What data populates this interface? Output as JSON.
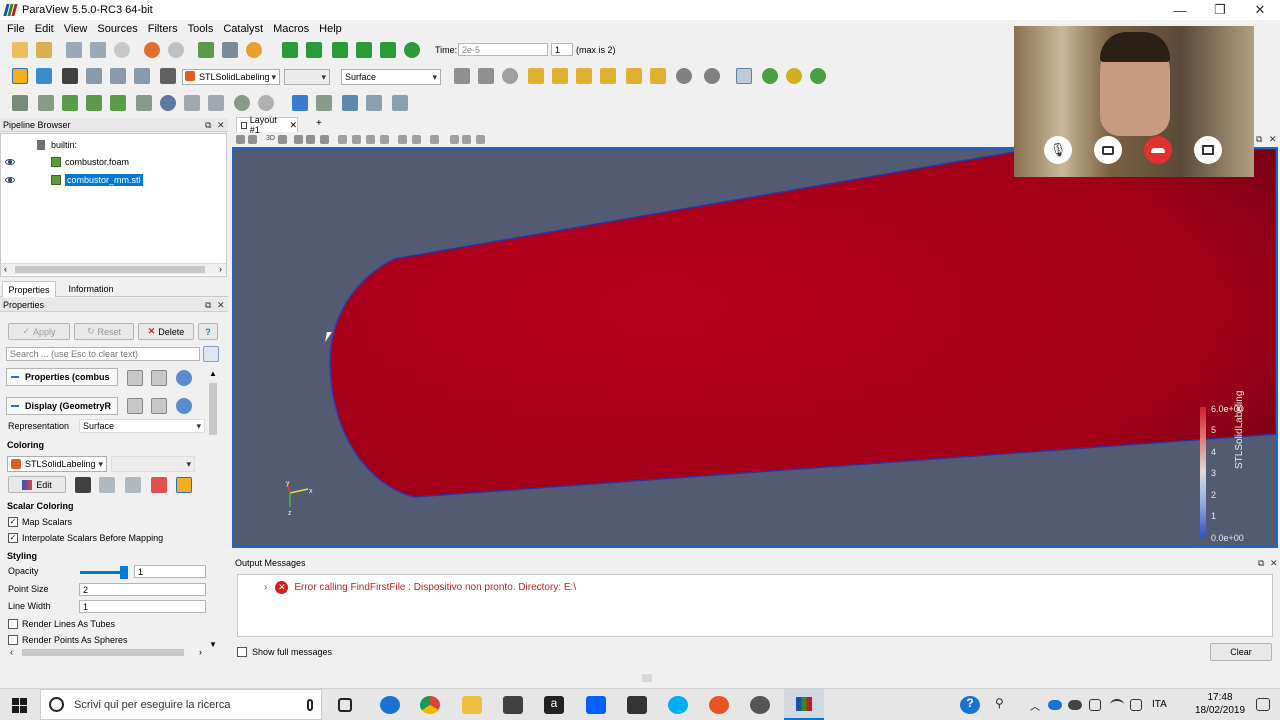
{
  "window": {
    "title": "ParaView 5.5.0-RC3 64-bit",
    "minimize": "—",
    "maximize": "❐",
    "close": "✕"
  },
  "menu": [
    "File",
    "Edit",
    "View",
    "Sources",
    "Filters",
    "Tools",
    "Catalyst",
    "Macros",
    "Help"
  ],
  "time": {
    "label": "Time:",
    "value": "2e-5",
    "step": "1",
    "max_label": "(max is 2)"
  },
  "toolbar": {
    "array_select": "STLSolidLabeling",
    "component_select": "",
    "representation_select": "Surface"
  },
  "pipeline": {
    "title": "Pipeline Browser",
    "root": "builtin:",
    "items": [
      {
        "label": "combustor.foam",
        "selected": false
      },
      {
        "label": "combustor_mm.stl",
        "selected": true
      }
    ]
  },
  "tabs": {
    "properties": "Properties",
    "information": "Information"
  },
  "properties": {
    "title": "Properties",
    "apply": "Apply",
    "reset": "Reset",
    "delete": "Delete",
    "help": "?",
    "search_placeholder": "Search ... (use Esc to clear text)",
    "section1": "Properties (combus",
    "section2": "Display (GeometryR",
    "representation_label": "Representation",
    "representation_value": "Surface",
    "coloring_heading": "Coloring",
    "coloring_array": "STLSolidLabeling",
    "edit": "Edit",
    "scalar_heading": "Scalar Coloring",
    "map_scalars": "Map Scalars",
    "interpolate": "Interpolate Scalars Before Mapping",
    "styling_heading": "Styling",
    "opacity_label": "Opacity",
    "opacity_value": "1",
    "opacity_level": 1.0,
    "point_size_label": "Point Size",
    "point_size_value": "2",
    "line_width_label": "Line Width",
    "line_width_value": "1",
    "lines_as_tubes": "Render Lines As Tubes",
    "points_as_spheres": "Render Points As Spheres"
  },
  "layout": {
    "tab": "Layout #1",
    "add": "+",
    "view_label": "3D"
  },
  "colorbar": {
    "title": "STLSolidLabeling",
    "ticks": [
      "6.0e+00",
      "5",
      "4",
      "3",
      "2",
      "1",
      "0.0e+00"
    ]
  },
  "axes": {
    "x": "x",
    "y": "y",
    "z": "z"
  },
  "output": {
    "title": "Output Messages",
    "message": "Error calling FindFirstFile : Dispositivo non pronto.  Directory: E:\\",
    "show_full": "Show full messages",
    "clear": "Clear"
  },
  "taskbar": {
    "search": "Scrivi qui per eseguire la ricerca",
    "lang": "ITA",
    "time": "17:48",
    "date": "18/02/2019"
  },
  "colors": {
    "mesh_red": "#b4001e",
    "background": "#525b72",
    "accent_blue": "#1e64c8",
    "selection": "#0078d7"
  }
}
